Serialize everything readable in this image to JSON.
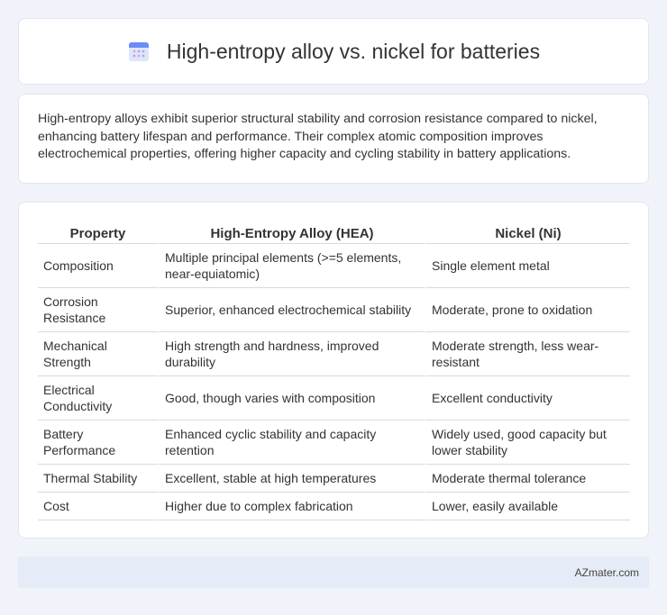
{
  "header": {
    "title": "High-entropy alloy vs. nickel for batteries",
    "icon": "calendar-icon"
  },
  "summary": {
    "text": "High-entropy alloys exhibit superior structural stability and corrosion resistance compared to nickel, enhancing battery lifespan and performance. Their complex atomic composition improves electrochemical properties, offering higher capacity and cycling stability in battery applications."
  },
  "table": {
    "headers": [
      "Property",
      "High-Entropy Alloy (HEA)",
      "Nickel (Ni)"
    ],
    "rows": [
      [
        "Composition",
        "Multiple principal elements (>=5 elements, near-equiatomic)",
        "Single element metal"
      ],
      [
        "Corrosion Resistance",
        "Superior, enhanced electrochemical stability",
        "Moderate, prone to oxidation"
      ],
      [
        "Mechanical Strength",
        "High strength and hardness, improved durability",
        "Moderate strength, less wear-resistant"
      ],
      [
        "Electrical Conductivity",
        "Good, though varies with composition",
        "Excellent conductivity"
      ],
      [
        "Battery Performance",
        "Enhanced cyclic stability and capacity retention",
        "Widely used, good capacity but lower stability"
      ],
      [
        "Thermal Stability",
        "Excellent, stable at high temperatures",
        "Moderate thermal tolerance"
      ],
      [
        "Cost",
        "Higher due to complex fabrication",
        "Lower, easily available"
      ]
    ]
  },
  "footer": {
    "brand": "AZmater.com"
  },
  "colors": {
    "background": "#f0f3f9",
    "card": "#ffffff",
    "footer": "#e6ecf7",
    "icon_primary": "#6b8df5",
    "icon_accent": "#e8a0c8"
  }
}
